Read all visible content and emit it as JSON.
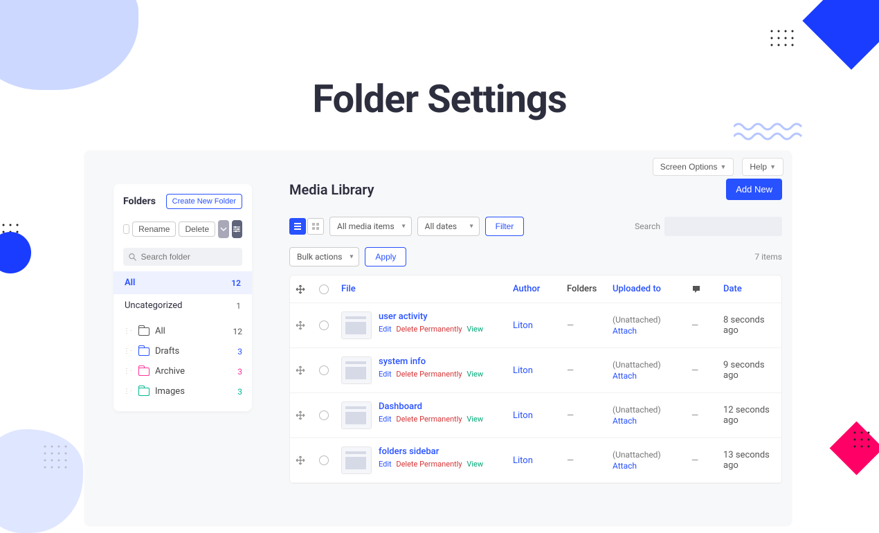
{
  "page_title": "Folder Settings",
  "top_tabs": {
    "screen_options": "Screen Options",
    "help": "Help"
  },
  "sidebar": {
    "title": "Folders",
    "create_btn": "Create New Folder",
    "rename_btn": "Rename",
    "delete_btn": "Delete",
    "search_placeholder": "Search folder",
    "filters": [
      {
        "label": "All",
        "count": "12",
        "active": true
      },
      {
        "label": "Uncategorized",
        "count": "1",
        "active": false
      }
    ],
    "tree": [
      {
        "label": "All",
        "count": "12",
        "color": "fc-default"
      },
      {
        "label": "Drafts",
        "count": "3",
        "color": "fc-blue"
      },
      {
        "label": "Archive",
        "count": "3",
        "color": "fc-pink"
      },
      {
        "label": "Images",
        "count": "3",
        "color": "fc-green"
      }
    ]
  },
  "main": {
    "title": "Media Library",
    "add_new": "Add New",
    "media_filter": "All media items",
    "date_filter": "All dates",
    "filter_btn": "Filter",
    "search_label": "Search",
    "bulk_label": "Bulk actions",
    "apply_btn": "Apply",
    "items_count": "7 items",
    "columns": {
      "file": "File",
      "author": "Author",
      "folders": "Folders",
      "uploaded": "Uploaded to",
      "date": "Date"
    },
    "row_actions": {
      "edit": "Edit",
      "delete": "Delete Permanently",
      "view": "View"
    },
    "uploaded_labels": {
      "unattached": "(Unattached)",
      "attach": "Attach"
    },
    "rows": [
      {
        "name": "user activity",
        "author": "Liton",
        "folders": "—",
        "comments": "—",
        "date": "8 seconds ago"
      },
      {
        "name": "system info",
        "author": "Liton",
        "folders": "—",
        "comments": "—",
        "date": "9 seconds ago"
      },
      {
        "name": "Dashboard",
        "author": "Liton",
        "folders": "—",
        "comments": "—",
        "date": "12 seconds ago"
      },
      {
        "name": "folders sidebar",
        "author": "Liton",
        "folders": "—",
        "comments": "—",
        "date": "13 seconds ago"
      }
    ]
  }
}
